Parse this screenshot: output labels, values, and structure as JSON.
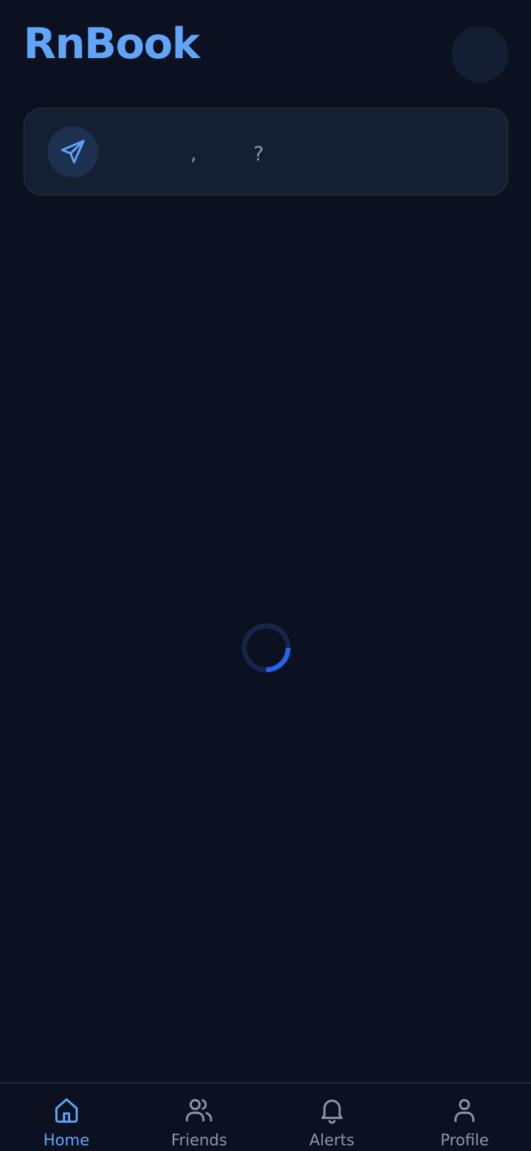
{
  "app": {
    "title": "RnBook"
  },
  "composer": {
    "prompt": "           ,         ?"
  },
  "loading": {
    "progress": 0.25
  },
  "tabbar": {
    "tabs": [
      {
        "label": "Home",
        "icon": "home-icon",
        "active": true
      },
      {
        "label": "Friends",
        "icon": "friends-icon",
        "active": false
      },
      {
        "label": "Alerts",
        "icon": "bell-icon",
        "active": false
      },
      {
        "label": "Profile",
        "icon": "user-icon",
        "active": false
      }
    ]
  },
  "colors": {
    "background": "#0b1120",
    "accent": "#60a5fa",
    "spinner": "#2563eb",
    "spinner_track": "#16254a",
    "muted": "#8b96a8"
  }
}
